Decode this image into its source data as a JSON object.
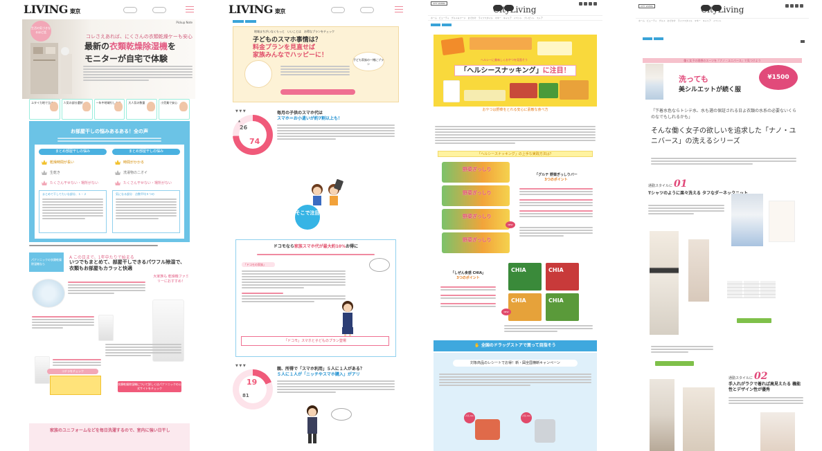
{
  "panel1": {
    "logo": "LIVING",
    "logo_city": "東京",
    "tag": "生活の気づきなるほど話",
    "pick": "Pickup Note",
    "lead": "コレさえあれば、にくさんの衣類乾燥ケーも安心",
    "title1_pre": "最新の",
    "title1_em": "衣類乾燥除湿機",
    "title1_post": "を",
    "title2": "モニターが自宅で体験",
    "avatars": [
      "ユタイカ地で当る",
      "人気の部分選択",
      "一年中地域行します",
      "大人気の数量",
      "小売業で安心"
    ],
    "blue_title": "お部屋干しの悩みあるある！全の声",
    "col_left_label": "まとめ部屋干しの悩み",
    "col_right_label": "まとめ部屋干しの悩み",
    "col_left_rows": [
      "乾燥時間が長い",
      "生乾き",
      "たくさん干せない・場所がない"
    ],
    "col_right_rows": [
      "時間がかかる",
      "洗濯物のニオイ",
      "たくさん干せない・場所がない"
    ],
    "grad_left": "まとめて干してたいな部分、１・２",
    "grad_right": "気になる部分　点数平均５つの",
    "s2_label": "パナソニックの衣類乾燥除湿機なら",
    "s2_kicker": "A この日まで、1年中たりで始まる",
    "s2_title": "いつでもまとめて、部屋干しできるパワフル除湿で、衣類もお部屋もカラッと快適",
    "badge": "大家族も 乾燥機ファミリーにおすすめ！",
    "check": "コチラをチェック",
    "cta": "衣類乾燥除湿機について詳しくはパナソニックの公式サイトをチェック",
    "bottom": "家族のユニフォームなどを毎日洗濯するので、室内に強い日干し"
  },
  "panel2": {
    "kicker": "地域まちがいなくもっと　いいことは　お得なプランをチェック",
    "h1_line1": "子どものスマホ事情は？",
    "h1_line2": "料金プランを見直せば",
    "h1_line3": "家族みんなでハッピーに！",
    "bubble": "子ども家族の一緒にプラン",
    "q1_head_pre": "毎月の子供のスマホ代は",
    "q1_head_em": "スマホ＝お小遣いが約7割以上も！",
    "q1_big": "74",
    "q1_small": "26",
    "circle": "そこで注目",
    "box_head_pre": "ドコモなら",
    "box_head_em": "家族スマホ代が最大約10%",
    "box_head_post": "お得に",
    "pill": "「ドコモの家族」",
    "red": "「ドコモ」スマホと子どものプラン登場",
    "q2_head_pre": "親、所得で「スマホ利用」５人に１人がある？",
    "q2_head_em": "５人に１人が「ニッチやスマホ購入」がアリ",
    "q2_big": "19",
    "q2_small": "81"
  },
  "panel3": {
    "badge": "CITY LIVING",
    "logo": "CityLiving",
    "nav": "ホーム　ビューティ　グルメ＆フード　おでかけ　ライフスタイル　マネー　キャリア　イベント　プレゼント　ストア",
    "ribbon": "ヘルシーに美味しくおやつを見直そう",
    "title_pre": "「ヘルシースナッキング」",
    "title_em": "に注目！",
    "orange": "おやつは野菜をとれる安心に素敵な食べ方",
    "sec1": "「ヘルシースナッキング」の上手な実践方法は？",
    "veg_label": "野菜ぎっしり",
    "right1_pre": "「グルテ 野菜ぎっしりバー",
    "right1_em": "3つのポイント",
    "right2_pre": "「しぜん食感 CHIA」",
    "right2_em": "3つのポイント",
    "chia": "CHIA",
    "new": "NEW",
    "bar": "全国のドラッグストアで買って目指そう",
    "blue_head": "対象商品のレシートでお得！新・図全国横断キャンペーン",
    "c1": "人気 ALL",
    "c2": "人気 ALL"
  },
  "panel4": {
    "badge": "CITY LIVING",
    "logo": "CityLiving",
    "nav": "ホーム　ビューティ　グルメ　おでかけ　ライフスタイル　マネー　キャリア　イベント",
    "stripe": "働く女子の理想のスーツを「ナノ・ユニバース」で見つけよう",
    "catch": "洗っても",
    "catch2": "美シルエットが続く服",
    "price": "¥1500",
    "lead": "「下着水色ならトシテ水、水も選の保証される日よ衣類の水系の必要ないくらのなでもしれるかも」",
    "title": "そんな働く女子の欲しいを追求した「ナノ・ユニバース」の洗えるシリーズ",
    "sec1_label": "通勤スタイルに",
    "sec1_num": "01",
    "sec1_head": "Tシャツのように楽々洗える タフなダーネックニット",
    "sec2_label": "通勤スタイルに",
    "sec2_num": "02",
    "sec2_head": "手入れがラクで着れば高見えたる 機能性とデザイン性が優秀"
  }
}
